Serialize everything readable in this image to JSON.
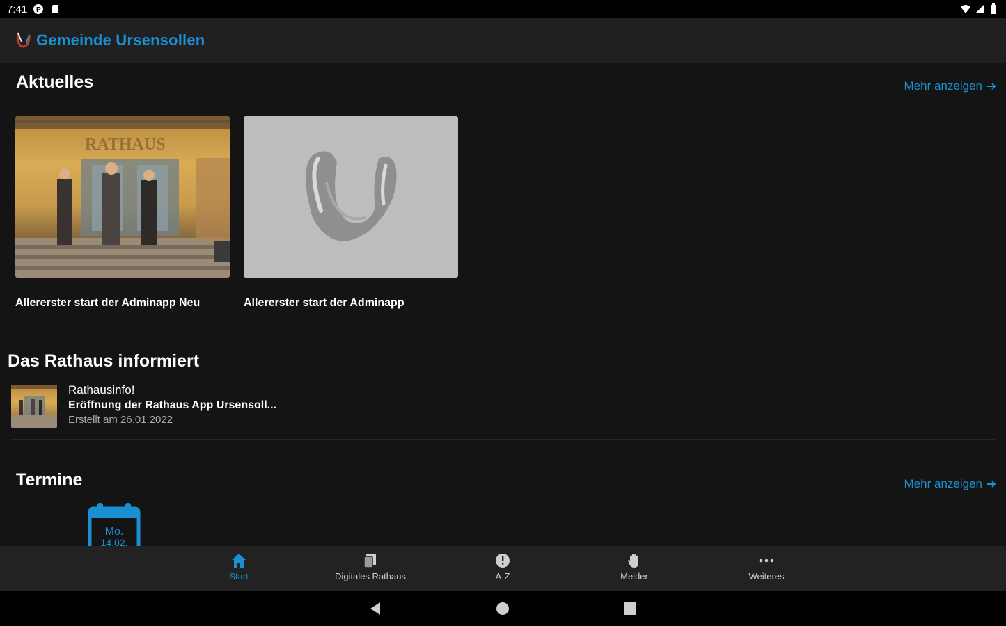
{
  "status_bar": {
    "time": "7:41"
  },
  "app_bar": {
    "title": "Gemeinde Ursensollen"
  },
  "aktuelles": {
    "title": "Aktuelles",
    "more_label": "Mehr anzeigen",
    "cards": [
      {
        "caption": "Allererster start der Adminapp Neu"
      },
      {
        "caption": "Allererster start der Adminapp"
      }
    ]
  },
  "rathaus_informiert": {
    "title": "Das Rathaus informiert",
    "items": [
      {
        "title": "Rathausinfo!",
        "subtitle": "Eröffnung der Rathaus App Ursensoll...",
        "date": "Erstellt am 26.01.2022"
      }
    ]
  },
  "termine": {
    "title": "Termine",
    "more_label": "Mehr anzeigen",
    "calendar": {
      "day": "Mo.",
      "date": "14.02."
    }
  },
  "bottom_nav": {
    "items": [
      {
        "label": "Start",
        "icon": "home-icon",
        "active": true
      },
      {
        "label": "Digitales Rathaus",
        "icon": "documents-icon",
        "active": false
      },
      {
        "label": "A-Z",
        "icon": "info-icon",
        "active": false
      },
      {
        "label": "Melder",
        "icon": "hand-icon",
        "active": false
      },
      {
        "label": "Weiteres",
        "icon": "more-icon",
        "active": false
      }
    ]
  },
  "colors": {
    "accent": "#1a8fd1",
    "background": "#141414",
    "app_bar": "#202020",
    "nav_bar": "#222222"
  }
}
